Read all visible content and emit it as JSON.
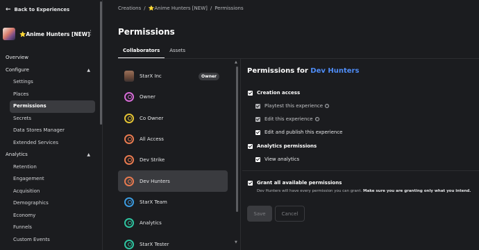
{
  "sidebar": {
    "back_label": "Back to Experiences",
    "experience_title": "⭐Anime Hunters [NEW]",
    "items": [
      {
        "label": "Overview",
        "level": 0
      },
      {
        "label": "Configure",
        "level": 0,
        "expanded": true
      },
      {
        "label": "Settings",
        "level": 1
      },
      {
        "label": "Places",
        "level": 1
      },
      {
        "label": "Permissions",
        "level": 1,
        "active": true
      },
      {
        "label": "Secrets",
        "level": 1
      },
      {
        "label": "Data Stores Manager",
        "level": 1
      },
      {
        "label": "Extended Services",
        "level": 1
      },
      {
        "label": "Analytics",
        "level": 0,
        "expanded": true
      },
      {
        "label": "Retention",
        "level": 1
      },
      {
        "label": "Engagement",
        "level": 1
      },
      {
        "label": "Acquisition",
        "level": 1
      },
      {
        "label": "Demographics",
        "level": 1
      },
      {
        "label": "Economy",
        "level": 1
      },
      {
        "label": "Funnels",
        "level": 1
      },
      {
        "label": "Custom Events",
        "level": 1
      }
    ]
  },
  "breadcrumb": [
    "Creations",
    "⭐Anime Hunters [NEW]",
    "Permissions"
  ],
  "page_title": "Permissions",
  "tabs": [
    {
      "label": "Collaborators",
      "active": true
    },
    {
      "label": "Assets",
      "active": false
    }
  ],
  "collaborators": [
    {
      "name": "StarX Inc",
      "icon": "user-avatar",
      "badge": "Owner"
    },
    {
      "name": "Owner",
      "icon": "role-icon",
      "color": "#d66bd6"
    },
    {
      "name": "Co Owner",
      "icon": "role-icon",
      "color": "#e3c233"
    },
    {
      "name": "All Access",
      "icon": "role-icon",
      "color": "#e87a4f"
    },
    {
      "name": "Dev Strike",
      "icon": "role-icon",
      "color": "#e87a4f"
    },
    {
      "name": "Dev Hunters",
      "icon": "role-icon",
      "color": "#e87a4f",
      "active": true
    },
    {
      "name": "StarX Team",
      "icon": "role-icon",
      "color": "#3b9be0"
    },
    {
      "name": "Analytics",
      "icon": "role-icon",
      "color": "#2ec4a0"
    },
    {
      "name": "StarX Tester",
      "icon": "role-icon",
      "color": "#2ec4a0"
    }
  ],
  "permissions": {
    "title_prefix": "Permissions for",
    "title_group": "Dev Hunters",
    "creation_access": "Creation access",
    "playtest": "Playtest this experience",
    "edit": "Edit this experience",
    "edit_publish": "Edit and publish this experience",
    "analytics_permissions": "Analytics permissions",
    "view_analytics": "View analytics",
    "grant_all": "Grant all available permissions",
    "grant_desc_plain": "Dev Hunters will have every permission you can grant.",
    "grant_desc_bold": "Make sure you are granting only what you intend.",
    "save": "Save",
    "cancel": "Cancel"
  }
}
